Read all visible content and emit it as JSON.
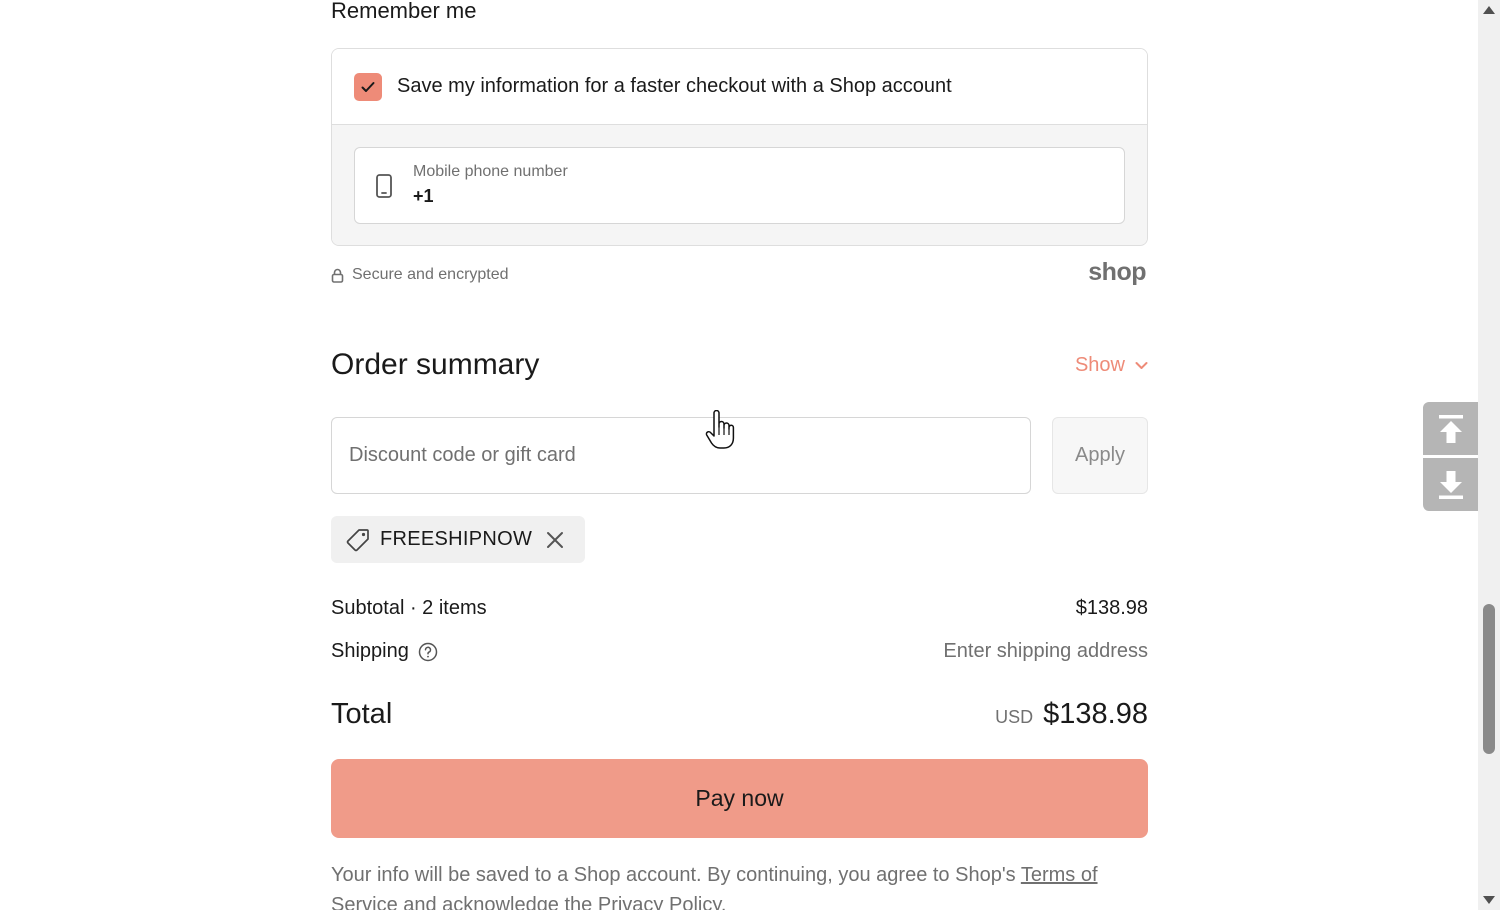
{
  "remember": {
    "heading": "Remember me",
    "save_label": "Save my information for a faster checkout with a Shop account",
    "save_checked": true,
    "phone_label": "Mobile phone number",
    "phone_value": "+1",
    "secure_text": "Secure and encrypted",
    "shop_logo": "shop"
  },
  "order_summary": {
    "title": "Order summary",
    "toggle_label": "Show",
    "discount_placeholder": "Discount code or gift card",
    "apply_label": "Apply",
    "applied_code": "FREESHIPNOW",
    "subtotal_label": "Subtotal · 2 items",
    "subtotal_value": "$138.98",
    "shipping_label": "Shipping",
    "shipping_value": "Enter shipping address",
    "total_label": "Total",
    "total_currency": "USD",
    "total_value": "$138.98"
  },
  "pay": {
    "button_label": "Pay now"
  },
  "legal": {
    "text_before": "Your info will be saved to a Shop account. By continuing, you agree to Shop's ",
    "terms_link": "Terms of Service",
    "text_middle": " and acknowledge the ",
    "privacy_link": "Privacy Policy",
    "text_after": "."
  },
  "colors": {
    "accent": "#ee8b78",
    "pay_button": "#f09b89",
    "muted_text": "#707070"
  },
  "icons": {
    "checkbox": "check-icon",
    "phone": "phone-icon",
    "secure": "lock-icon",
    "toggle": "chevron-down-icon",
    "code_tag": "tag-icon",
    "code_remove": "close-icon",
    "shipping_help": "help-circle-icon",
    "scroll_top": "arrow-up-to-line-icon",
    "scroll_bottom": "arrow-down-to-line-icon"
  }
}
